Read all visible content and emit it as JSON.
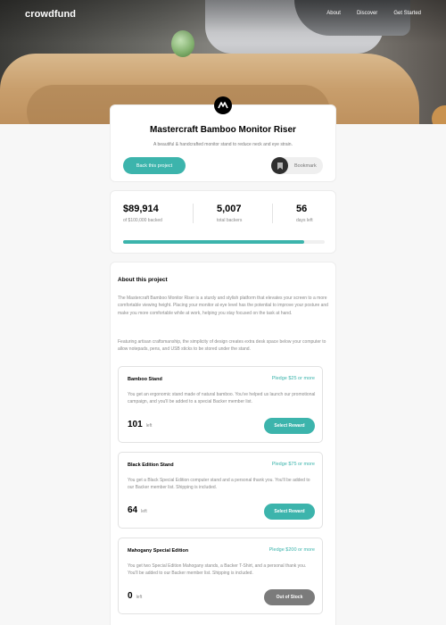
{
  "nav": {
    "logo": "crowdfund",
    "links": [
      "About",
      "Discover",
      "Get Started"
    ]
  },
  "project": {
    "logo_icon": "mastercraft-logo-icon",
    "title": "Mastercraft Bamboo Monitor Riser",
    "subtitle": "A beautiful & handcrafted monitor stand to reduce neck and eye strain.",
    "back_label": "Back this project",
    "bookmark_label": "Bookmark",
    "bookmark_icon": "bookmark-icon"
  },
  "stats": {
    "backed_value": "$89,914",
    "backed_label": "of $100,000 backed",
    "backers_value": "5,007",
    "backers_label": "total backers",
    "days_value": "56",
    "days_label": "days left",
    "progress_fraction": 0.899
  },
  "about": {
    "heading": "About this project",
    "paragraphs": [
      "The Mastercraft Bamboo Monitor Riser is a sturdy and stylish platform that elevates your screen to a more comfortable viewing height. Placing your monitor at eye level has the potential to improve your posture and make you more comfortable while at work, helping you stay focused on the task at hand.",
      "Featuring artisan craftsmanship, the simplicity of design creates extra desk space below your computer to allow notepads, pens, and USB sticks to be stored under the stand."
    ]
  },
  "rewards": [
    {
      "name": "Bamboo Stand",
      "pledge": "Pledge $25 or more",
      "description": "You get an ergonomic stand made of natural bamboo. You've helped us launch our promotional campaign, and you'll be added to a special Backer member list.",
      "left_count": "101",
      "left_word": "left",
      "button": "Select Reward",
      "available": true
    },
    {
      "name": "Black Edition Stand",
      "pledge": "Pledge $75 or more",
      "description": "You get a Black Special Edition computer stand and a personal thank you. You'll be added to our Backer member list. Shipping is included.",
      "left_count": "64",
      "left_word": "left",
      "button": "Select Reward",
      "available": true
    },
    {
      "name": "Mahogany Special Edition",
      "pledge": "Pledge $200 or more",
      "description": "You get two Special Edition Mahogany stands, a Backer T-Shirt, and a personal thank you. You'll be added to our Backer member list. Shipping is included.",
      "left_count": "0",
      "left_word": "left",
      "button": "Out of Stock",
      "available": false
    }
  ],
  "colors": {
    "accent": "#3cb4ac",
    "disabled": "#7b7b7b"
  }
}
